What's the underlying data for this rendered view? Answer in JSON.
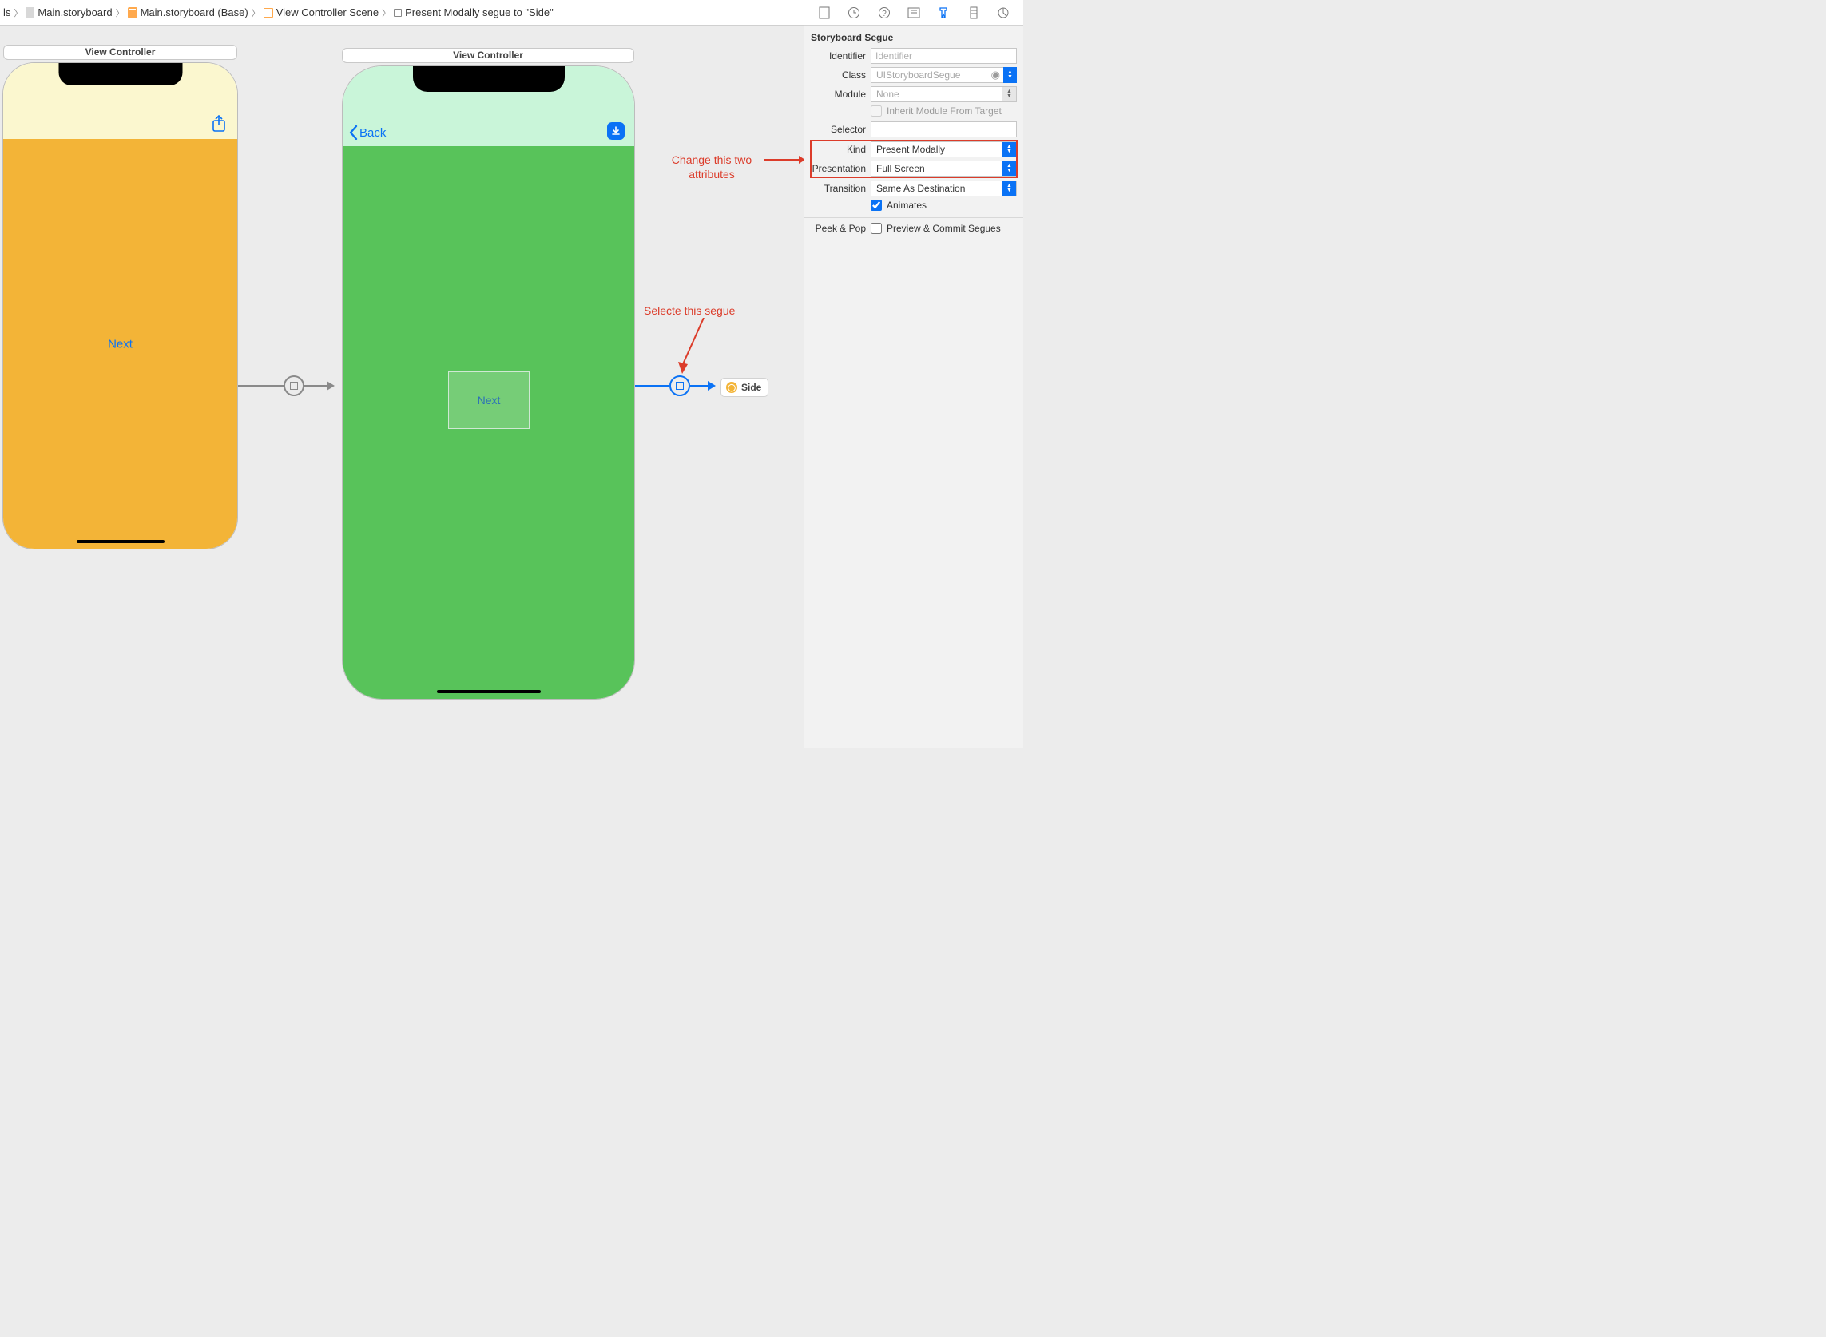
{
  "breadcrumb": {
    "c0": "ls",
    "c1": "Main.storyboard",
    "c2": "Main.storyboard (Base)",
    "c3": "View Controller Scene",
    "c4": "Present Modally segue to \"Side\""
  },
  "vc1": {
    "title": "View Controller",
    "next_label": "Next"
  },
  "vc2": {
    "title": "View Controller",
    "back_label": "Back",
    "next_label": "Next"
  },
  "side_chip": "Side",
  "annotations": {
    "attrs_l1": "Change this two",
    "attrs_l2": "attributes",
    "segue": "Selecte this segue"
  },
  "inspector": {
    "heading": "Storyboard Segue",
    "identifier": {
      "label": "Identifier",
      "placeholder": "Identifier"
    },
    "klass": {
      "label": "Class",
      "value": "UIStoryboardSegue"
    },
    "module": {
      "label": "Module",
      "value": "None"
    },
    "inherit": "Inherit Module From Target",
    "selector": {
      "label": "Selector"
    },
    "kind": {
      "label": "Kind",
      "value": "Present Modally"
    },
    "presentation": {
      "label": "Presentation",
      "value": "Full Screen"
    },
    "transition": {
      "label": "Transition",
      "value": "Same As Destination"
    },
    "animates": "Animates",
    "peekpop": {
      "label": "Peek & Pop",
      "value": "Preview & Commit Segues"
    }
  }
}
